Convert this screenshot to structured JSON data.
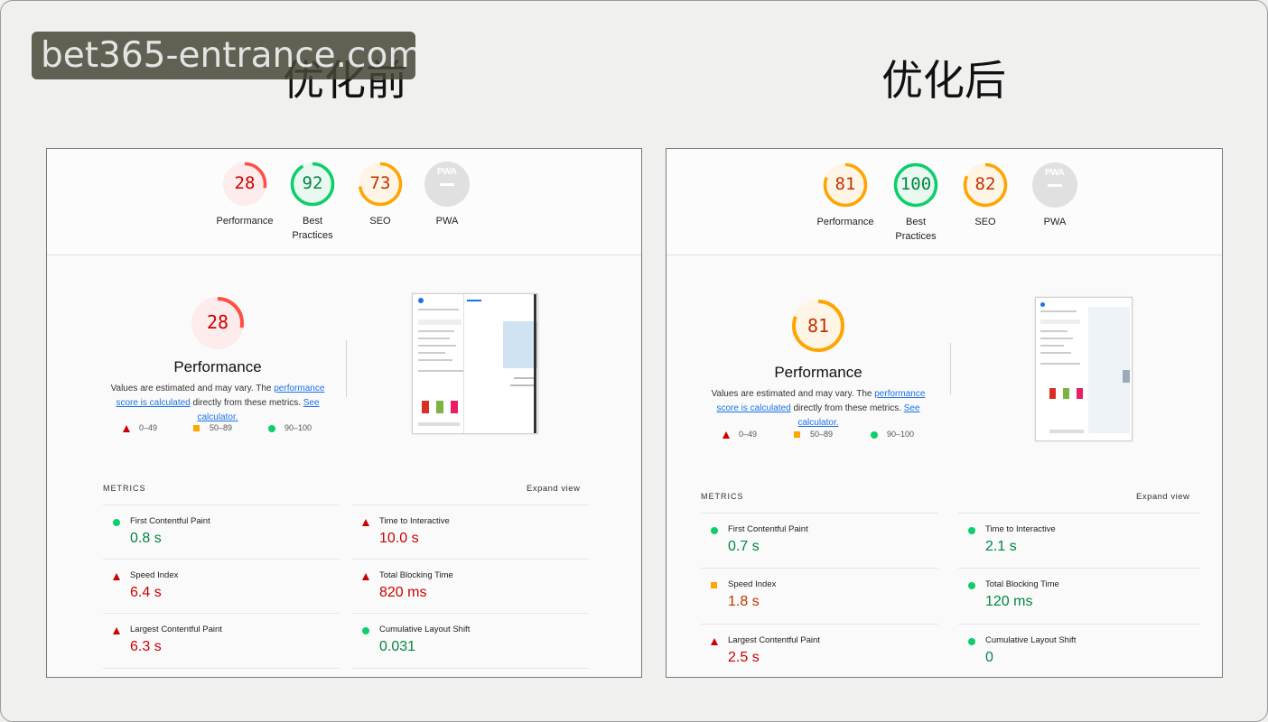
{
  "headings": {
    "before": "优化前",
    "after": "优化后"
  },
  "watermark": "bet365-entrance.com",
  "colors": {
    "fail": "#ff4e42",
    "average": "#ffa400",
    "pass": "#0cce6b",
    "fail_text": "#cc0000",
    "average_text": "#c33300",
    "pass_text": "#018642"
  },
  "before": {
    "scores": [
      {
        "label": "Performance",
        "value": "28",
        "fraction": 0.28,
        "rating": "fail"
      },
      {
        "label": "Best Practices",
        "value": "92",
        "fraction": 0.92,
        "rating": "pass"
      },
      {
        "label": "SEO",
        "value": "73",
        "fraction": 0.73,
        "rating": "average"
      },
      {
        "label": "PWA",
        "value": "",
        "icon": "pwa-icon"
      }
    ],
    "big_score": "28",
    "big_fraction": 0.28,
    "big_title": "Performance",
    "desc_prefix": "Values are estimated and may vary. The ",
    "desc_link1": "performance score is calculated",
    "desc_mid": " directly from these metrics. ",
    "desc_link2": "See calculator.",
    "legend": [
      "0–49",
      "50–89",
      "90–100"
    ],
    "metrics_title": "METRICS",
    "expand_label": "Expand view",
    "metrics": [
      {
        "name": "First Contentful Paint",
        "value": "0.8 s",
        "rating": "pass"
      },
      {
        "name": "Time to Interactive",
        "value": "10.0 s",
        "rating": "fail"
      },
      {
        "name": "Speed Index",
        "value": "6.4 s",
        "rating": "fail"
      },
      {
        "name": "Total Blocking Time",
        "value": "820 ms",
        "rating": "fail"
      },
      {
        "name": "Largest Contentful Paint",
        "value": "6.3 s",
        "rating": "fail"
      },
      {
        "name": "Cumulative Layout Shift",
        "value": "0.031",
        "rating": "pass"
      }
    ]
  },
  "after": {
    "scores": [
      {
        "label": "Performance",
        "value": "81",
        "fraction": 0.81,
        "rating": "average"
      },
      {
        "label": "Best Practices",
        "value": "100",
        "fraction": 1.0,
        "rating": "pass"
      },
      {
        "label": "SEO",
        "value": "82",
        "fraction": 0.82,
        "rating": "average"
      },
      {
        "label": "PWA",
        "value": "",
        "icon": "pwa-icon"
      }
    ],
    "big_score": "81",
    "big_fraction": 0.81,
    "big_title": "Performance",
    "desc_prefix": "Values are estimated and may vary. The ",
    "desc_link1": "performance score is calculated",
    "desc_mid": " directly from these metrics. ",
    "desc_link2": "See calculator.",
    "legend": [
      "0–49",
      "50–89",
      "90–100"
    ],
    "metrics_title": "METRICS",
    "expand_label": "Expand view",
    "metrics": [
      {
        "name": "First Contentful Paint",
        "value": "0.7 s",
        "rating": "pass"
      },
      {
        "name": "Time to Interactive",
        "value": "2.1 s",
        "rating": "pass"
      },
      {
        "name": "Speed Index",
        "value": "1.8 s",
        "rating": "average"
      },
      {
        "name": "Total Blocking Time",
        "value": "120 ms",
        "rating": "pass"
      },
      {
        "name": "Largest Contentful Paint",
        "value": "2.5 s",
        "rating": "fail"
      },
      {
        "name": "Cumulative Layout Shift",
        "value": "0",
        "rating": "pass"
      }
    ]
  }
}
